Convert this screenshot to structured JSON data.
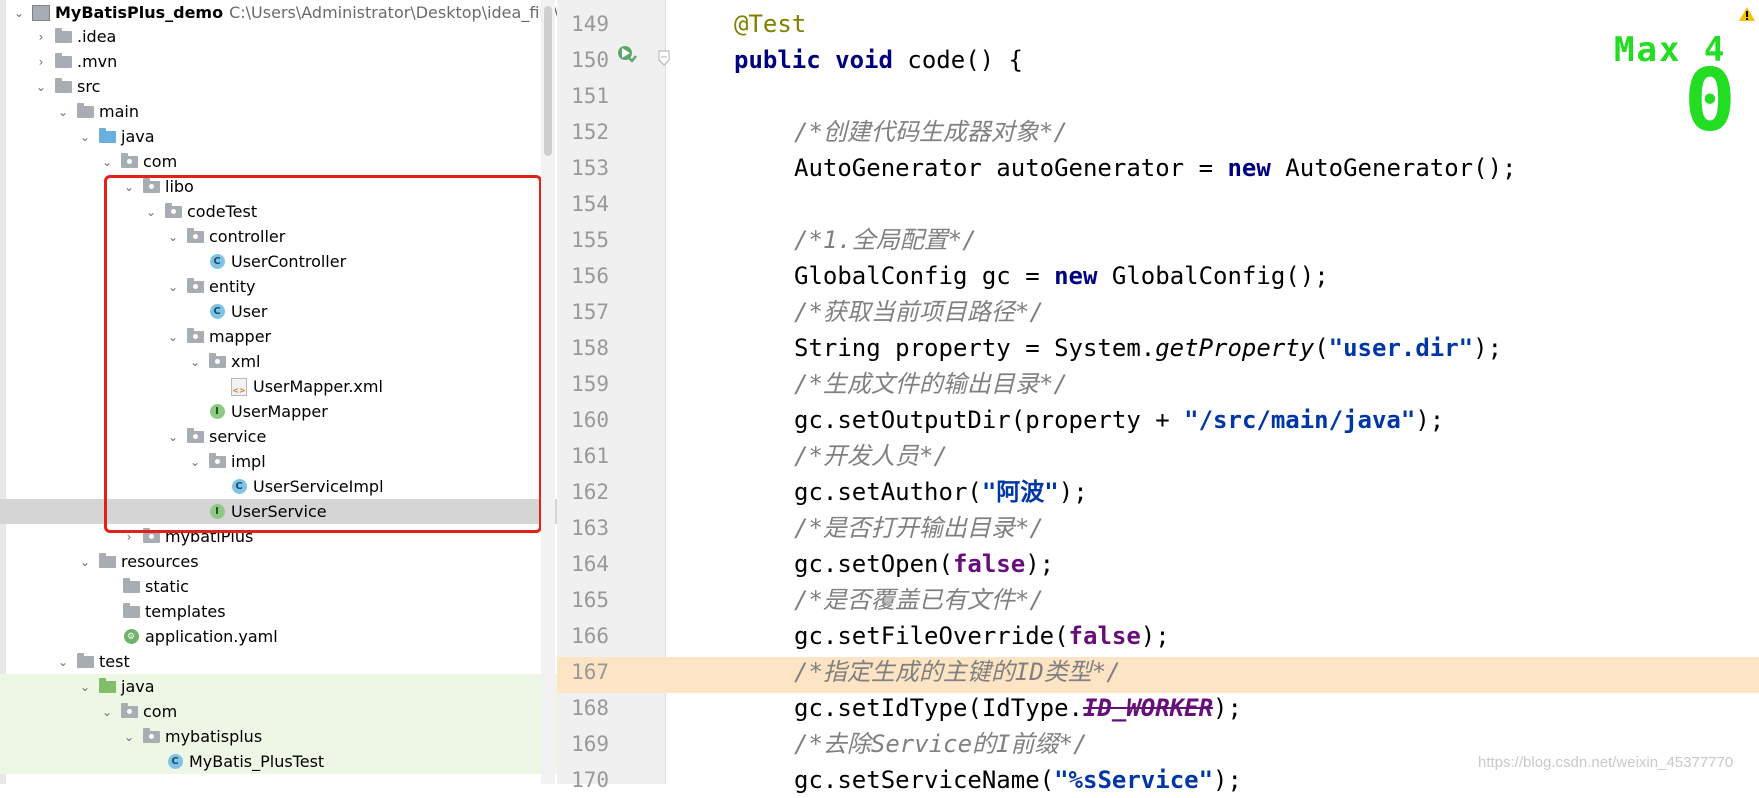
{
  "project_tree": {
    "root_name": "MyBatisPlus_demo",
    "root_path": "C:\\Users\\Administrator\\Desktop\\idea_file\\MyBa",
    "items": [
      {
        "label": ".idea"
      },
      {
        "label": ".mvn"
      },
      {
        "label": "src"
      },
      {
        "label": "main"
      },
      {
        "label": "java"
      },
      {
        "label": "com"
      },
      {
        "label": "libo"
      },
      {
        "label": "codeTest"
      },
      {
        "label": "controller"
      },
      {
        "label": "UserController"
      },
      {
        "label": "entity"
      },
      {
        "label": "User"
      },
      {
        "label": "mapper"
      },
      {
        "label": "xml"
      },
      {
        "label": "UserMapper.xml"
      },
      {
        "label": "UserMapper"
      },
      {
        "label": "service"
      },
      {
        "label": "impl"
      },
      {
        "label": "UserServiceImpl"
      },
      {
        "label": "UserService"
      },
      {
        "label": "mybatiPlus"
      },
      {
        "label": "resources"
      },
      {
        "label": "static"
      },
      {
        "label": "templates"
      },
      {
        "label": "application.yaml"
      },
      {
        "label": "test"
      },
      {
        "label": "java"
      },
      {
        "label": "com"
      },
      {
        "label": "mybatisplus"
      },
      {
        "label": "MyBatis_PlusTest"
      }
    ],
    "selected": "UserService",
    "icon_badges": {
      "class": "C",
      "interface": "I"
    }
  },
  "editor": {
    "line_numbers": [
      "149",
      "150",
      "151",
      "152",
      "153",
      "154",
      "155",
      "156",
      "157",
      "158",
      "159",
      "160",
      "161",
      "162",
      "163",
      "164",
      "165",
      "166",
      "167",
      "168",
      "169",
      "170"
    ],
    "highlighted_line": "167",
    "code": {
      "l149": "@Test",
      "l150_kw": "public void",
      "l150_rest": " code() {",
      "l152": "/*创建代码生成器对象*/",
      "l153_a": "AutoGenerator autoGenerator = ",
      "l153_kw": "new",
      "l153_b": " AutoGenerator();",
      "l155": "/*1.全局配置*/",
      "l156_a": "GlobalConfig gc = ",
      "l156_kw": "new",
      "l156_b": " GlobalConfig();",
      "l157": "/*获取当前项目路径*/",
      "l158_a": "String property = System.",
      "l158_m": "getProperty",
      "l158_b": "(",
      "l158_s": "\"user.dir\"",
      "l158_c": ");",
      "l159": "/*生成文件的输出目录*/",
      "l160_a": "gc.setOutputDir(property + ",
      "l160_s": "\"/src/main/java\"",
      "l160_b": ");",
      "l161": "/*开发人员*/",
      "l162_a": "gc.setAuthor(",
      "l162_s": "\"阿波\"",
      "l162_b": ");",
      "l163": "/*是否打开输出目录*/",
      "l164_a": "gc.setOpen(",
      "l164_kw": "false",
      "l164_b": ");",
      "l165": "/*是否覆盖已有文件*/",
      "l166_a": "gc.setFileOverride(",
      "l166_kw": "false",
      "l166_b": ");",
      "l167": "/*指定生成的主键的ID类型*/",
      "l168_a": "gc.setIdType(IdType.",
      "l168_c": "ID_WORKER",
      "l168_b": ");",
      "l169": "/*去除Service的I前缀*/",
      "l170_a": "gc.setServiceName(",
      "l170_s": "\"%sService\"",
      "l170_b": ");"
    }
  },
  "overlay": {
    "max_label": "Max 4",
    "score": "0",
    "color": "#22dd22"
  },
  "watermark": "https://blog.csdn.net/weixin_45377770",
  "colors": {
    "keyword": "#000080",
    "comment": "#808080",
    "string": "#0037a6",
    "highlight": "#fde4c4",
    "red_box": "#e4201b"
  }
}
